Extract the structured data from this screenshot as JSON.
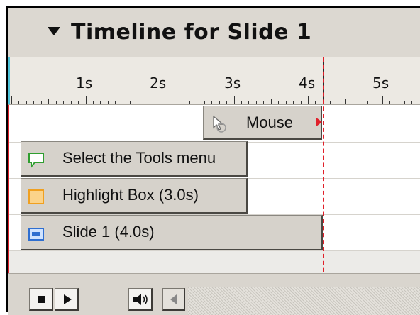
{
  "title_bar": {
    "title": "Timeline for Slide 1",
    "collapse_icon": "triangle-down-icon"
  },
  "ruler": {
    "labels": [
      "1s",
      "2s",
      "3s",
      "4s",
      "5s"
    ]
  },
  "playhead": {
    "time_seconds": 4.0
  },
  "tracks": [
    {
      "label": "Mouse",
      "icon": "mouse-cursor-icon"
    },
    {
      "label": "Select the Tools menu",
      "icon": "caption-icon"
    },
    {
      "label": "Highlight Box (3.0s)",
      "icon": "highlight-box-icon"
    },
    {
      "label": "Slide 1 (4.0s)",
      "icon": "slide-icon"
    }
  ],
  "controls": {
    "stop_icon": "stop-icon",
    "play_icon": "play-icon",
    "audio_icon": "speaker-icon",
    "scroll_icon": "scroll-left-icon"
  },
  "colors": {
    "playhead": "#e0202a",
    "ruler_start": "#4cc3d9",
    "caption_icon": "#2f9e2f",
    "highlight_icon": "#f0a020",
    "slide_icon": "#2f6fd0"
  }
}
